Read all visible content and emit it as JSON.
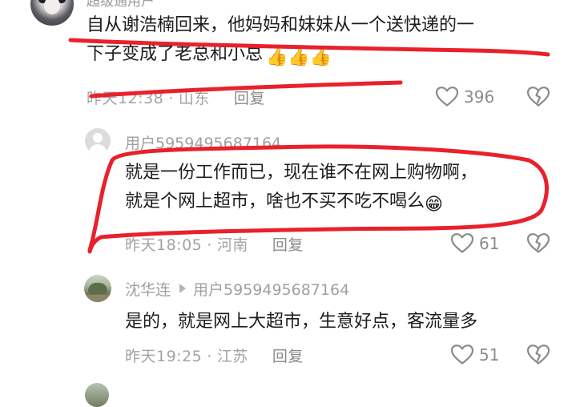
{
  "top_partial_username": "超级通用户",
  "comment1": {
    "line1": "自从谢浩楠回来，他妈妈和妹妹从一个送快递的一",
    "line2": "下子变成了老总和小总",
    "emoji": "👍👍👍",
    "time": "昨天12:38",
    "location": "山东",
    "reply_label": "回复",
    "likes": "396"
  },
  "comment2": {
    "username": "用户5959495687164",
    "line1": "就是一份工作而已，现在谁不在网上购物啊，",
    "line2": "就是个网上超市，啥也不买不吃不喝么",
    "emoji": "😁",
    "time": "昨天18:05",
    "location": "河南",
    "reply_label": "回复",
    "likes": "61"
  },
  "comment3": {
    "username": "沈华连",
    "reply_to": "用户5959495687164",
    "line1": "是的，就是网上大超市，生意好点，客流量多",
    "time": "昨天19:25",
    "location": "江苏",
    "reply_label": "回复",
    "likes": "51"
  },
  "icons": {
    "like": "heart-outline-icon",
    "dislike": "broken-heart-icon",
    "reply_indicator": "triangle-right-icon"
  },
  "colors": {
    "annotation_red": "#e8212c",
    "meta_gray": "#a3a3a3",
    "text": "#1c1c1c"
  }
}
